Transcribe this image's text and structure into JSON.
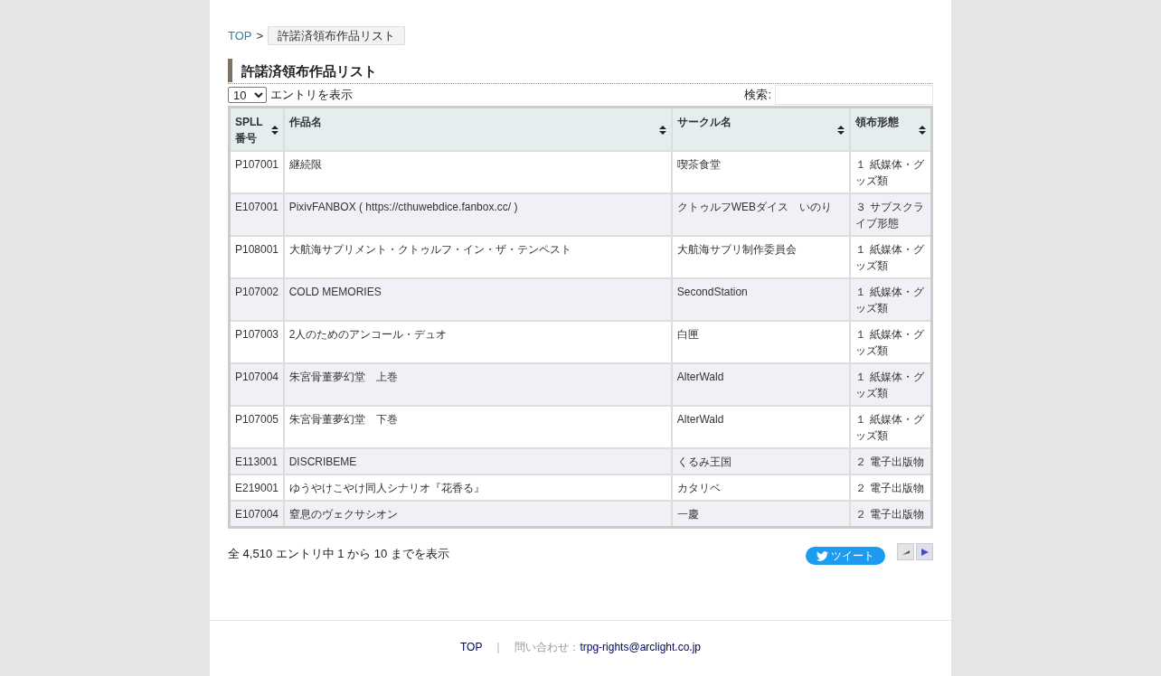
{
  "breadcrumb": {
    "home": "TOP",
    "separator": ">",
    "current": "許諾済領布作品リスト"
  },
  "heading": "許諾済領布作品リスト",
  "length_menu": {
    "value": "10",
    "label": "エントリを表示"
  },
  "search": {
    "label": "検索:"
  },
  "table": {
    "columns": [
      "SPLL番号",
      "作品名",
      "サークル名",
      "領布形態"
    ],
    "rows": [
      [
        "P107001",
        "継続限",
        "喫茶食堂",
        "１ 紙媒体・グッズ類"
      ],
      [
        "E107001",
        "PixivFANBOX ( https://cthuwebdice.fanbox.cc/ )",
        "クトゥルフWEBダイス　いのり",
        "３ サブスクライブ形態"
      ],
      [
        "P108001",
        "大航海サプリメント・クトゥルフ・イン・ザ・テンペスト",
        "大航海サプリ制作委員会",
        "１ 紙媒体・グッズ類"
      ],
      [
        "P107002",
        "COLD MEMORIES",
        "SecondStation",
        "１ 紙媒体・グッズ類"
      ],
      [
        "P107003",
        "2人のためのアンコール・デュオ",
        "白匣",
        "１ 紙媒体・グッズ類"
      ],
      [
        "P107004",
        "朱宮骨董夢幻堂　上巻",
        "AlterWald",
        "１ 紙媒体・グッズ類"
      ],
      [
        "P107005",
        "朱宮骨董夢幻堂　下巻",
        "AlterWald",
        "１ 紙媒体・グッズ類"
      ],
      [
        "E113001",
        "DISCRIBEME",
        "くるみ王国",
        "２ 電子出版物"
      ],
      [
        "E219001",
        "ゆうやけこやけ同人シナリオ『花香る』",
        "カタリベ",
        "２ 電子出版物"
      ],
      [
        "E107004",
        "窒息のヴェクサシオン",
        "一慶",
        "２ 電子出版物"
      ]
    ]
  },
  "info": "全 4,510 エントリ中 1 から 10 までを表示",
  "tweet_button": "ツイート",
  "pager": {
    "previous_disabled": true,
    "next_disabled": false
  },
  "footer": {
    "top_link": "TOP",
    "separator": "｜",
    "contact_label": "問い合わせ：",
    "contact_email": "trpg-rights@arclight.co.jp"
  }
}
